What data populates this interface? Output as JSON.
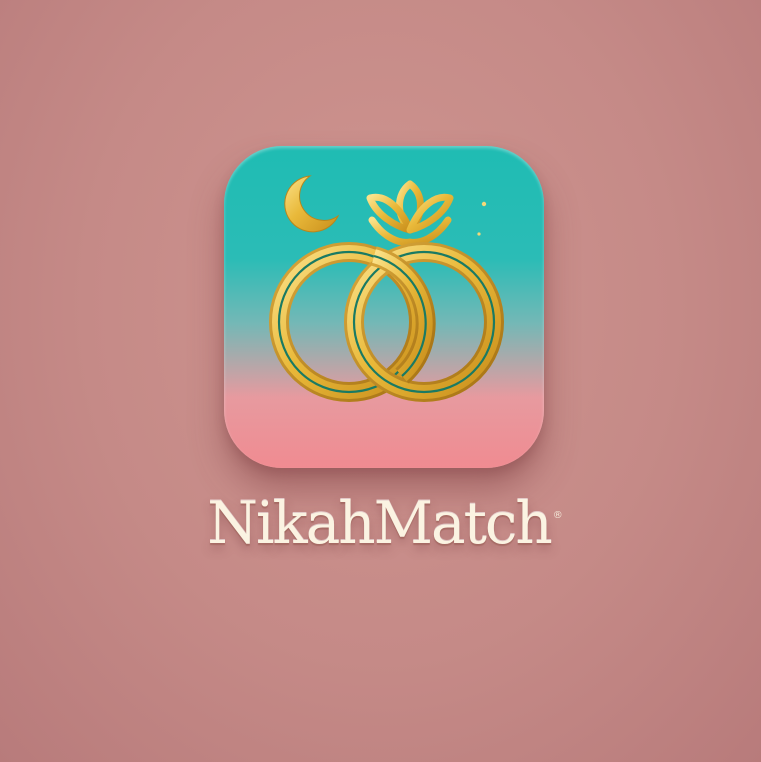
{
  "logo": {
    "brand_name": "NikahMatch",
    "registered_symbol": "®",
    "icons": [
      "crescent-moon-icon",
      "interlocked-rings-icon",
      "lotus-crown-icon",
      "sparkle-icon"
    ]
  },
  "colors": {
    "background": "#c58a87",
    "icon_gradient_top": "#1fbcb3",
    "icon_gradient_bottom": "#f08b91",
    "gold": "#e9b93a",
    "wordmark": "#fbf3e2"
  }
}
